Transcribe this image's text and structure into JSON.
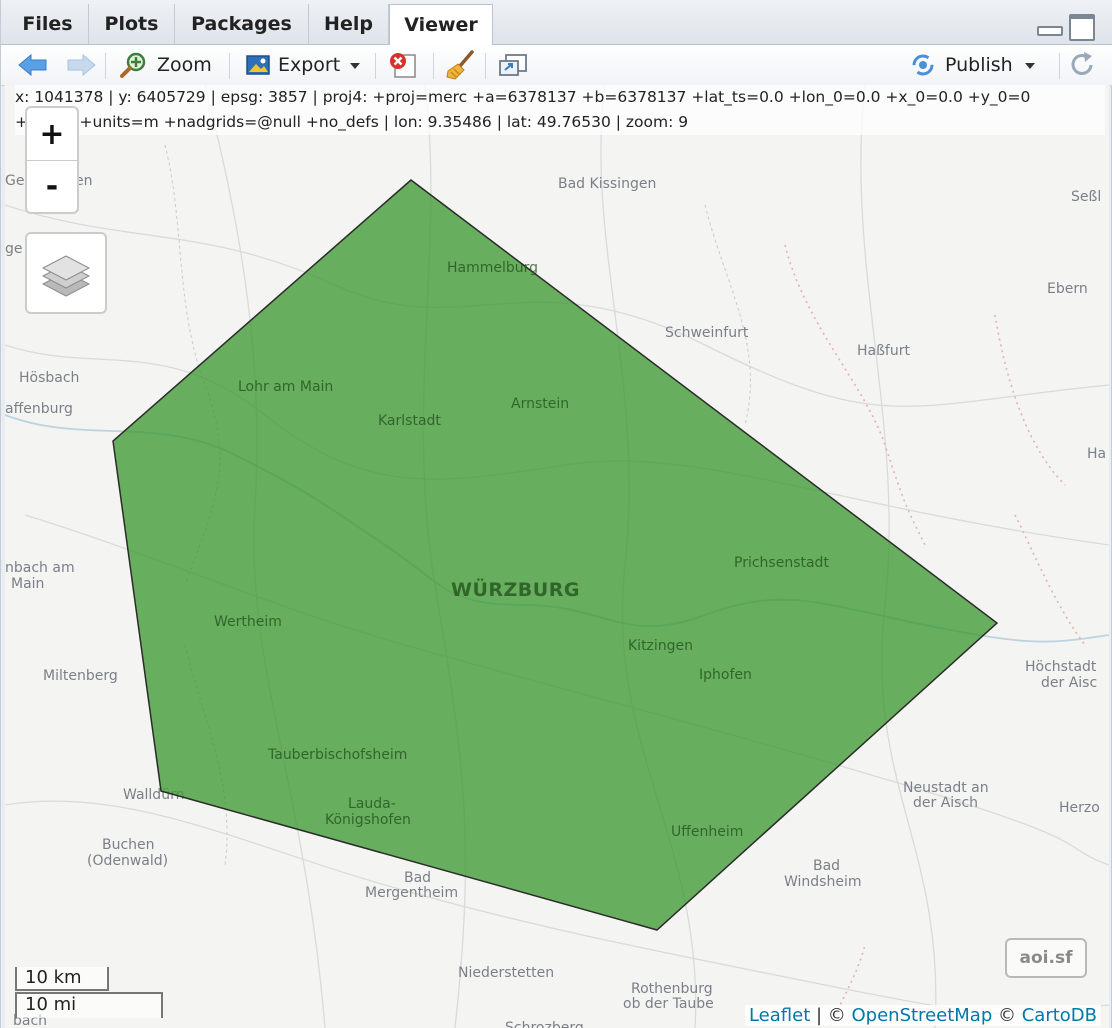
{
  "tabs": [
    "Files",
    "Plots",
    "Packages",
    "Help",
    "Viewer"
  ],
  "active_tab": "Viewer",
  "toolbar": {
    "zoom_label": "Zoom",
    "export_label": "Export",
    "publish_label": "Publish"
  },
  "map_info": {
    "line1": "x: 1041378 | y: 6405729 | epsg: 3857 | proj4: +proj=merc +a=6378137 +b=6378137 +lat_ts=0.0 +lon_0=0.0 +x_0=0.0 +y_0=0",
    "line2": "+k=1.0 +units=m +nadgrids=@null +no_defs | lon: 9.35486 | lat: 49.76530 | zoom: 9"
  },
  "zoom_controls": {
    "in": "+",
    "out": "-"
  },
  "scale": {
    "km": "10 km",
    "mi": "10 mi"
  },
  "attribution": {
    "leaflet": "Leaflet",
    "sep1": " | © ",
    "osm": "OpenStreetMap",
    "sep2": " © ",
    "carto": "CartoDB"
  },
  "layer_badge": "aoi.sf",
  "polygon": {
    "fill": "#3f9a34",
    "stroke": "#2b2b2b"
  },
  "places": {
    "bad_kissingen": "Bad Kissingen",
    "sessl": "Seßl",
    "hammelburg": "Hammelburg",
    "ebern": "Ebern",
    "schweinfurt": "Schweinfurt",
    "hassfurt": "Haßfurt",
    "hoesbach": "Hösbach",
    "lohr": "Lohr am Main",
    "affenburg": "affenburg",
    "karlstadt": "Karlstadt",
    "arnstein": "Arnstein",
    "ha": "Ha",
    "prichsenstadt": "Prichsenstadt",
    "nbach1": "nbach am",
    "nbach2": "Main",
    "wuerzburg": "WÜRZBURG",
    "wertheim": "Wertheim",
    "kitzingen": "Kitzingen",
    "hoechstadt1": "Höchstadt",
    "hoechstadt2": "der Aisc",
    "miltenberg": "Miltenberg",
    "iphofen": "Iphofen",
    "tauber": "Tauberbischofsheim",
    "neustadt1": "Neustadt an",
    "neustadt2": "der Aisch",
    "wallduern": "Walldürn",
    "lauda1": "Lauda-",
    "lauda2": "Königshofen",
    "herzo": "Herzo",
    "buchen1": "Buchen",
    "buchen2": "(Odenwald)",
    "uffenheim": "Uffenheim",
    "badwind1": "Bad",
    "badwind2": "Windsheim",
    "badmerg1": "Bad",
    "badmerg2": "Mergentheim",
    "niederstetten": "Niederstetten",
    "rothenburg1": "Rothenburg",
    "rothenburg2": "ob der Taube",
    "gel": "Gel",
    "en": "en",
    "ge": "ge",
    "bach": "bach",
    "schroz": "Schrozberg"
  }
}
